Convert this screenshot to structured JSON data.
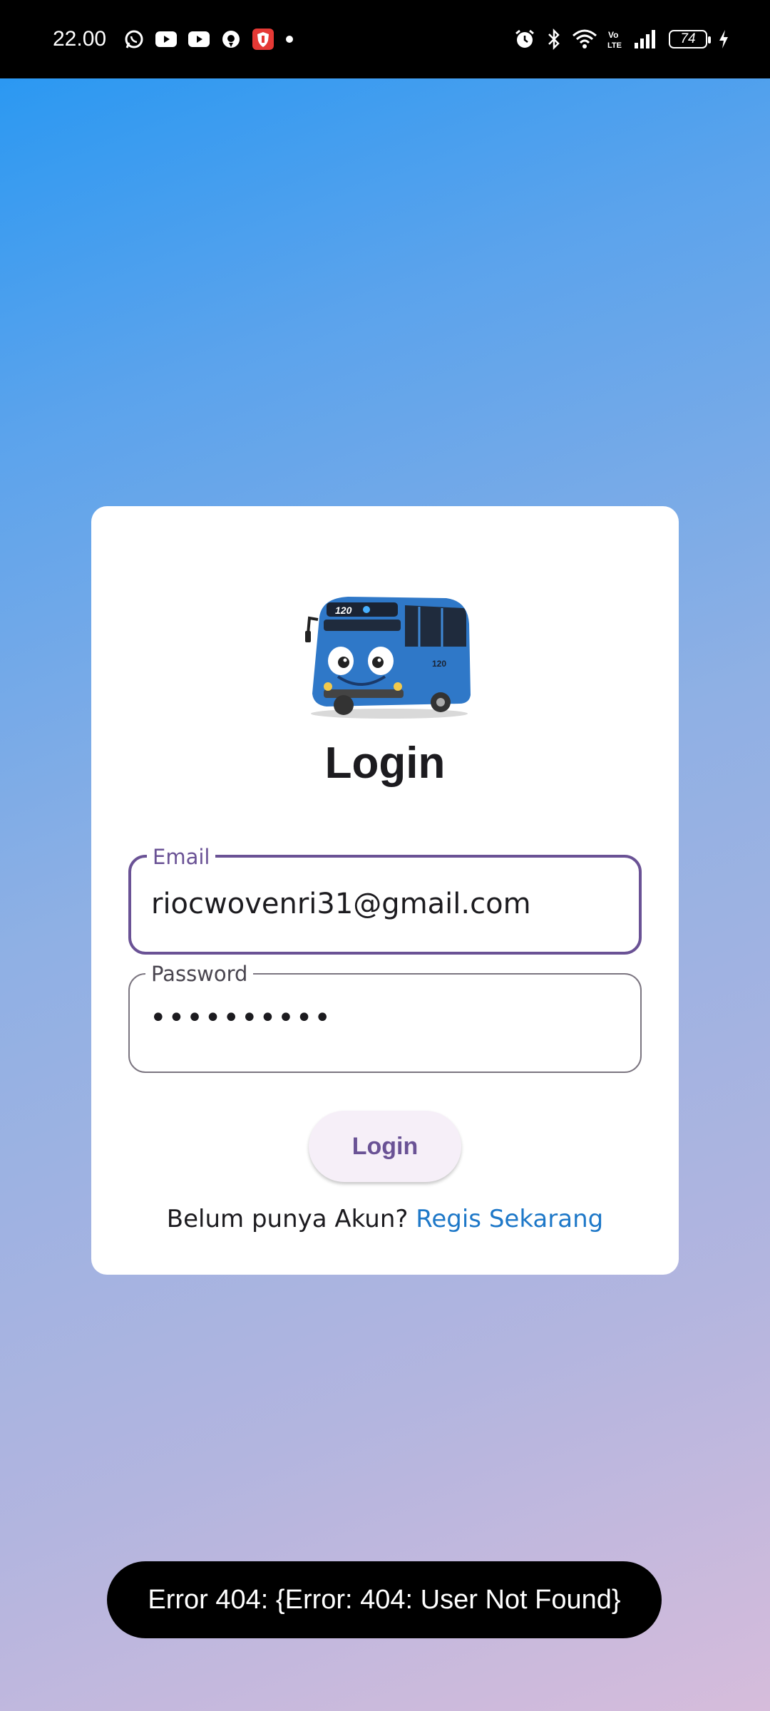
{
  "status_bar": {
    "time": "22.00",
    "notification_icons": [
      "whatsapp-icon",
      "youtube-icon",
      "youtube-icon",
      "location-icon",
      "shield-app-icon",
      "dot-icon"
    ],
    "system_icons": [
      "alarm-icon",
      "bluetooth-icon",
      "wifi-icon",
      "volte-icon",
      "signal-icon"
    ],
    "battery_level": "74"
  },
  "login_card": {
    "logo": "bus-icon",
    "title": "Login",
    "email": {
      "label": "Email",
      "value": "riocwovenri31@gmail.com"
    },
    "password": {
      "label": "Password",
      "value": "••••••••••"
    },
    "login_button_label": "Login",
    "register_prompt": "Belum punya Akun? ",
    "register_link": "Regis Sekarang"
  },
  "toast": {
    "message": "Error 404: {Error: 404: User Not Found}"
  },
  "colors": {
    "accent": "#6A5295",
    "link": "#1E78C8",
    "gradient_top": "#2196F3",
    "gradient_bottom": "#D6BCDB"
  }
}
